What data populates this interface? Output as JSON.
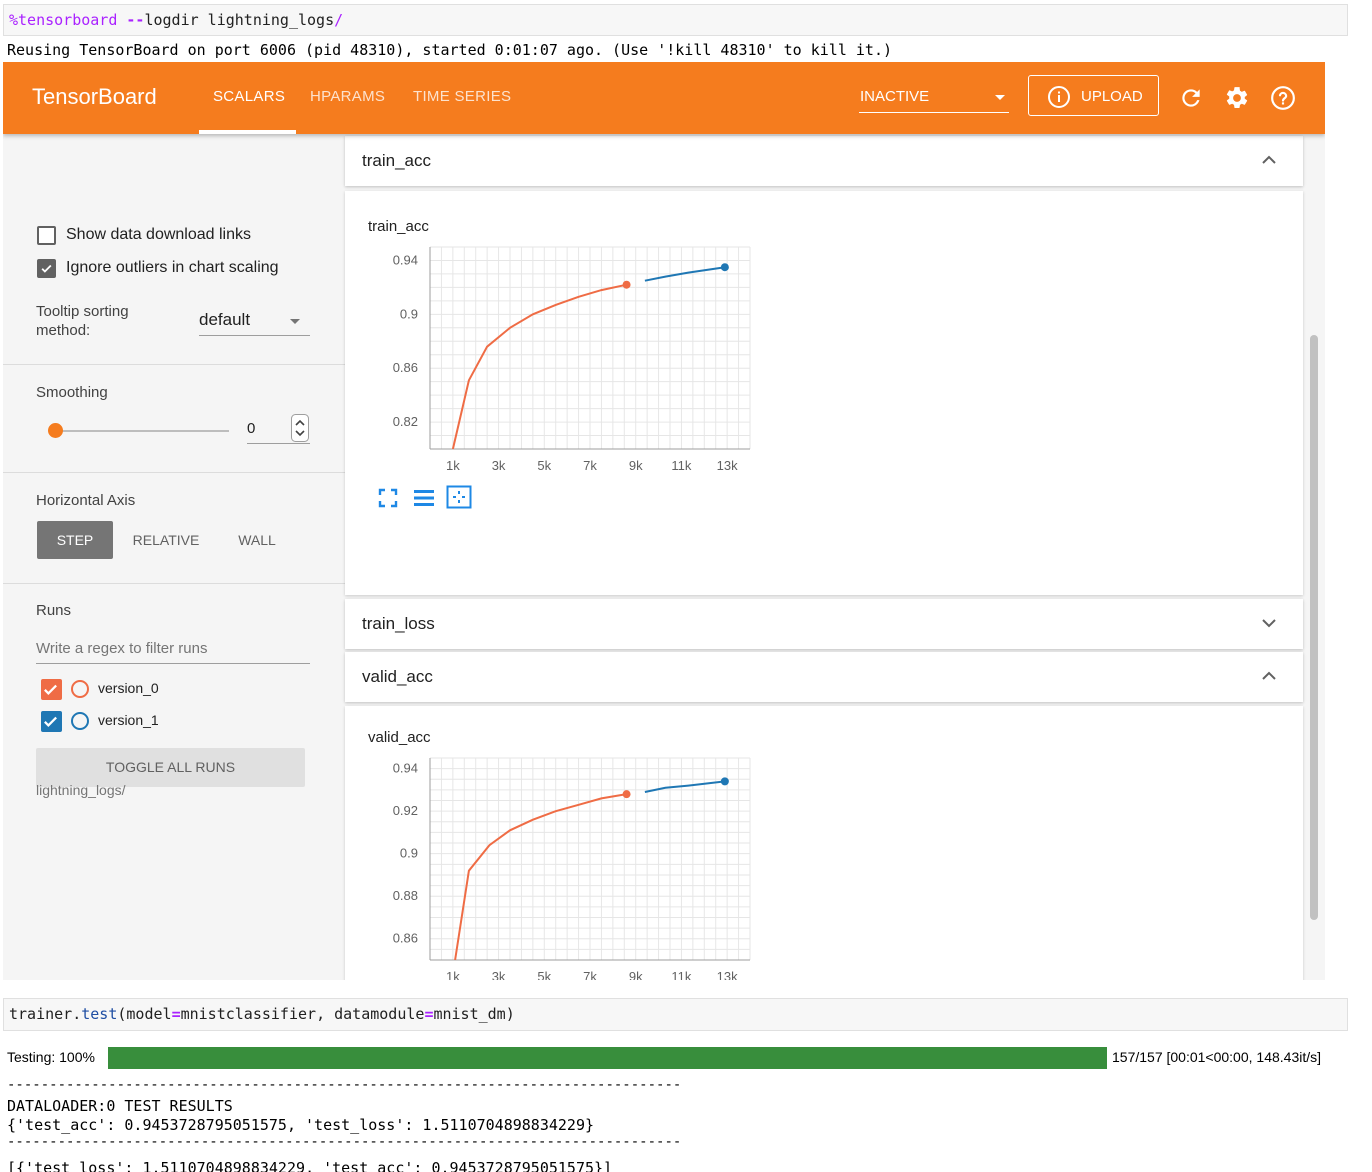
{
  "notebook": {
    "cell1": {
      "magic": "%tensorboard",
      "flag": "--",
      "args": "logdir lightning_logs",
      "slash": "/"
    },
    "output1": "Reusing TensorBoard on port 6006 (pid 48310), started 0:01:07 ago. (Use '!kill 48310' to kill it.)",
    "cell2": {
      "obj": "trainer",
      "dot": ".",
      "method": "test",
      "open": "(",
      "kw1": "model",
      "eq": "=",
      "val1": "mnistclassifier",
      "sep": ", ",
      "kw2": "datamodule",
      "val2": "mnist_dm",
      "close": ")"
    },
    "progress": {
      "label": "Testing: 100%",
      "fraction": 1.0,
      "stats": "157/157 [00:01<00:00, 148.43it/s]"
    },
    "results": {
      "rule": "--------------------------------------------------------------------------------",
      "heading": "DATALOADER:0 TEST RESULTS",
      "dict_line": "{'test_acc': 0.9453728795051575, 'test_loss': 1.5110704898834229}",
      "rule2": "--------------------------------------------------------------------------------",
      "list_line": "[{'test_loss': 1.5110704898834229, 'test_acc': 0.9453728795051575}]"
    }
  },
  "tensorboard": {
    "brand": "TensorBoard",
    "tabs": [
      {
        "label": "SCALARS"
      },
      {
        "label": "HPARAMS"
      },
      {
        "label": "TIME SERIES"
      }
    ],
    "status_select": "INACTIVE",
    "upload_label": "UPLOAD",
    "icons": {
      "refresh": "refresh-icon",
      "settings": "gear-icon",
      "help": "help-icon",
      "info": "info-icon"
    },
    "colors": {
      "header": "#f57c1e",
      "run0": "#ef6c45",
      "run1": "#1f77b4"
    },
    "sidebar": {
      "show_download_links": "Show data download links",
      "show_download_checked": false,
      "ignore_outliers": "Ignore outliers in chart scaling",
      "ignore_outliers_checked": true,
      "tooltip_label_1": "Tooltip sorting",
      "tooltip_label_2": "method:",
      "tooltip_value": "default",
      "smoothing_label": "Smoothing",
      "smoothing_value": "0",
      "horizontal_axis_label": "Horizontal Axis",
      "axis_options": [
        "STEP",
        "RELATIVE",
        "WALL"
      ],
      "axis_selected": "STEP",
      "runs_label": "Runs",
      "runs_filter_placeholder": "Write a regex to filter runs",
      "runs": [
        {
          "name": "version_0",
          "checked": true
        },
        {
          "name": "version_1",
          "checked": true
        }
      ],
      "toggle_all": "TOGGLE ALL RUNS",
      "logdir": "lightning_logs/"
    },
    "cards": [
      {
        "title": "train_acc",
        "expanded": true
      },
      {
        "title": "train_loss",
        "expanded": false
      },
      {
        "title": "valid_acc",
        "expanded": true
      }
    ]
  },
  "chart_data": [
    {
      "type": "line",
      "title": "train_acc",
      "xlim": [
        0,
        14000
      ],
      "ylim": [
        0.8,
        0.95
      ],
      "x_ticks": [
        "1k",
        "3k",
        "5k",
        "7k",
        "9k",
        "11k",
        "13k"
      ],
      "y_ticks": [
        "0.82",
        "0.86",
        "0.9",
        "0.94"
      ],
      "y_tick_values": [
        0.82,
        0.86,
        0.9,
        0.94
      ],
      "grid": true,
      "series": [
        {
          "name": "version_0",
          "color": "#ef6c45",
          "x": [
            1000,
            1700,
            2500,
            3500,
            4500,
            5500,
            6500,
            7500,
            8600
          ],
          "y": [
            0.8,
            0.851,
            0.876,
            0.89,
            0.9,
            0.907,
            0.913,
            0.918,
            0.922
          ]
        },
        {
          "name": "version_1",
          "color": "#1f77b4",
          "x": [
            9400,
            10300,
            11300,
            12900
          ],
          "y": [
            0.925,
            0.928,
            0.931,
            0.935
          ]
        }
      ]
    },
    {
      "type": "line",
      "title": "valid_acc",
      "xlim": [
        0,
        14000
      ],
      "ylim": [
        0.85,
        0.945
      ],
      "x_ticks": [
        "1k",
        "3k",
        "5k",
        "7k",
        "9k",
        "11k",
        "13k"
      ],
      "y_ticks": [
        "0.86",
        "0.88",
        "0.9",
        "0.92",
        "0.94"
      ],
      "y_tick_values": [
        0.86,
        0.88,
        0.9,
        0.92,
        0.94
      ],
      "grid": true,
      "series": [
        {
          "name": "version_0",
          "color": "#ef6c45",
          "x": [
            1100,
            1700,
            2600,
            3500,
            4500,
            5500,
            6500,
            7500,
            8600
          ],
          "y": [
            0.85,
            0.892,
            0.904,
            0.911,
            0.916,
            0.92,
            0.923,
            0.926,
            0.928
          ]
        },
        {
          "name": "version_1",
          "color": "#1f77b4",
          "x": [
            9400,
            10300,
            11300,
            12900
          ],
          "y": [
            0.929,
            0.931,
            0.932,
            0.934
          ]
        }
      ]
    }
  ]
}
